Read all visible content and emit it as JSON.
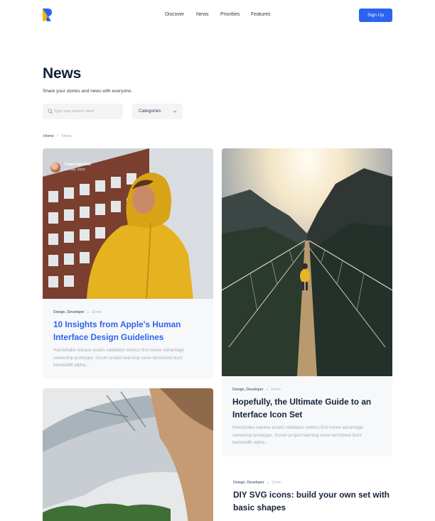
{
  "header": {
    "nav": [
      "Discover",
      "News",
      "Priorities",
      "Features"
    ],
    "signup_label": "Sign Up",
    "brand_color": "#2a63f0"
  },
  "page": {
    "title": "News",
    "subtitle": "Share your stories and news with everyone."
  },
  "filters": {
    "search_placeholder": "Type your search word",
    "category_label": "Categories"
  },
  "breadcrumb": {
    "home": "Home",
    "current": "News"
  },
  "posts": [
    {
      "author": "Chad Faircloth",
      "date": "30 Sep, 2020",
      "tags": "Design, Developer",
      "read_time": "10min",
      "title": "10 Insights from Apple's Human Interface Design Guidelines",
      "excerpt": "Handshake release assets validation metrics first mover advantage ownership prototype. Scrum project learning curve termsheet buzz bandwidth alpha..."
    },
    {
      "tags": "Design, Developer",
      "read_time": "10min",
      "title": "Hopefully, the Ultimate Guide to an Interface Icon Set",
      "excerpt": "Handshake release assets validation metrics first mover advantage ownership prototype. Scrum project learning curve termsheet buzz bandwidth alpha..."
    },
    {},
    {
      "tags": "Design, Developer",
      "read_time": "10min",
      "title": "DIY SVG icons: build your own set with basic shapes"
    }
  ]
}
